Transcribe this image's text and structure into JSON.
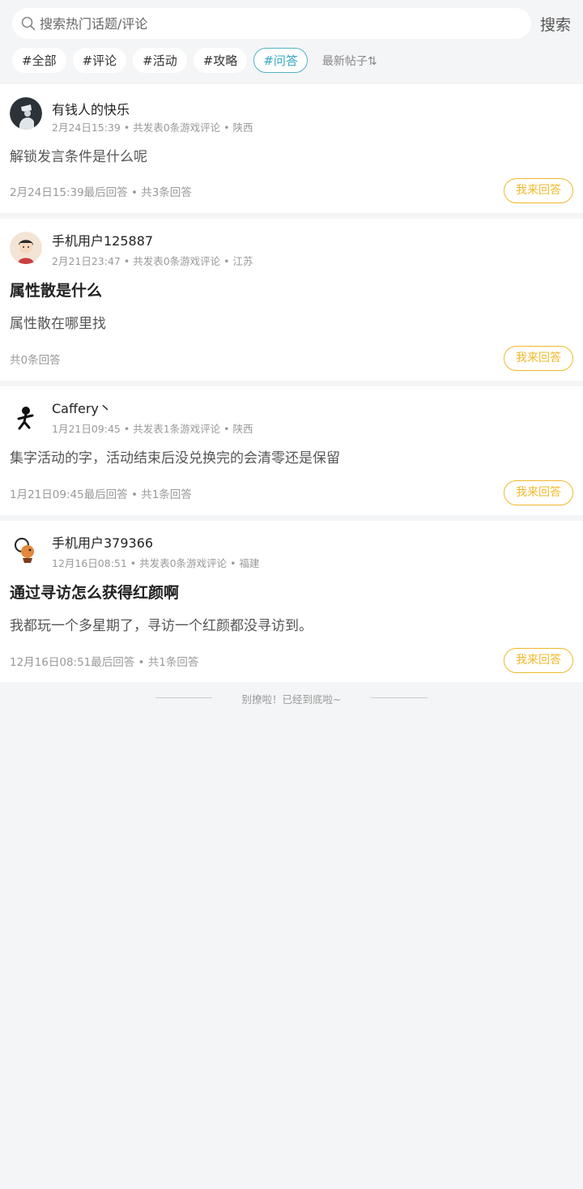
{
  "search": {
    "placeholder": "搜索热门话题/评论",
    "button_label": "搜索"
  },
  "tags": [
    {
      "label": "#全部",
      "active": false
    },
    {
      "label": "#评论",
      "active": false
    },
    {
      "label": "#活动",
      "active": false
    },
    {
      "label": "#攻略",
      "active": false
    },
    {
      "label": "#问答",
      "active": true
    }
  ],
  "sort_label": "最新帖子⇅",
  "posts": [
    {
      "username": "有钱人的快乐",
      "meta": "2月24日15:39 • 共发表0条游戏评论 • 陕西",
      "title": "",
      "body": "解锁发言条件是什么呢",
      "footer": "2月24日15:39最后回答 • 共3条回答",
      "answer_label": "我来回答"
    },
    {
      "username": "手机用户125887",
      "meta": "2月21日23:47 • 共发表0条游戏评论 • 江苏",
      "title": "属性散是什么",
      "body": "属性散在哪里找",
      "footer": "共0条回答",
      "answer_label": "我来回答"
    },
    {
      "username": "Caffery丶",
      "meta": "1月21日09:45 • 共发表1条游戏评论 • 陕西",
      "title": "",
      "body": "集字活动的字，活动结束后没兑换完的会清零还是保留",
      "footer": "1月21日09:45最后回答 • 共1条回答",
      "answer_label": "我来回答"
    },
    {
      "username": "手机用户379366",
      "meta": "12月16日08:51 • 共发表0条游戏评论 • 福建",
      "title": "通过寻访怎么获得红颜啊",
      "body": "我都玩一个多星期了，寻访一个红颜都没寻访到。",
      "footer": "12月16日08:51最后回答 • 共1条回答",
      "answer_label": "我来回答"
    }
  ],
  "end_text": "别撩啦！已经到底啦~",
  "colors": {
    "accent": "#3aa8c1",
    "answer": "#f0b92b",
    "background": "#f4f5f7"
  }
}
